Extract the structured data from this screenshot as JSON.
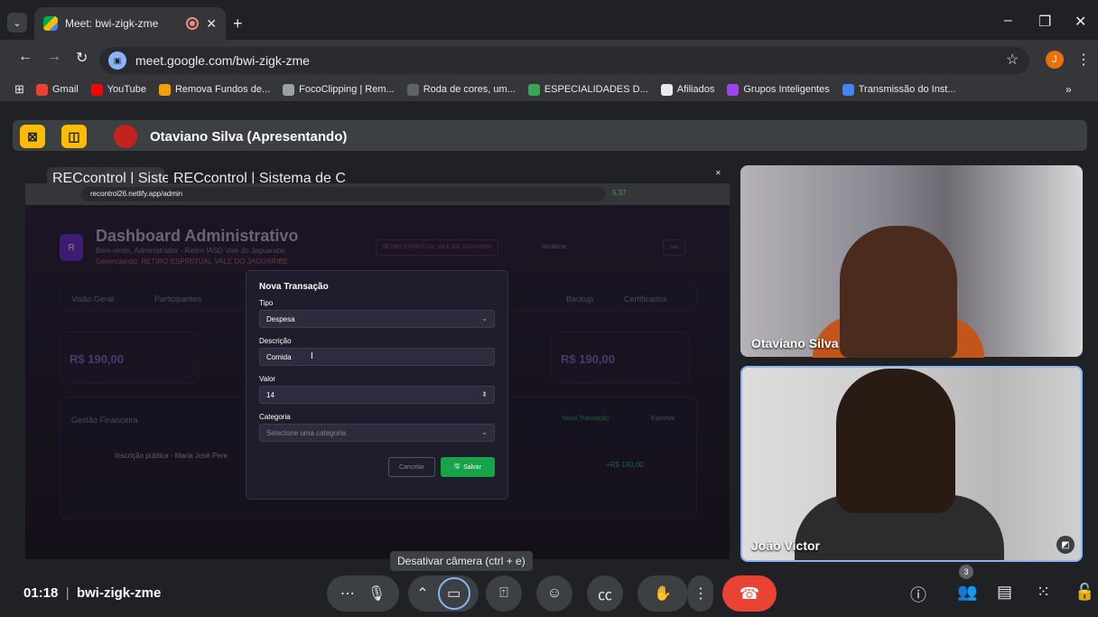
{
  "browser": {
    "tab_title": "Meet: bwi-zigk-zme",
    "url": "meet.google.com/bwi-zigk-zme",
    "profile_initial": "J",
    "bookmarks": [
      {
        "label": "Gmail",
        "color": "#ea4335"
      },
      {
        "label": "YouTube",
        "color": "#ff0000"
      },
      {
        "label": "Remova Fundos de...",
        "color": "#f59e0b"
      },
      {
        "label": "FocoClipping | Rem...",
        "color": "#9aa0a6"
      },
      {
        "label": "Roda de cores, um...",
        "color": "#5f6368"
      },
      {
        "label": "ESPECIALIDADES D...",
        "color": "#34a853"
      },
      {
        "label": "Afiliados",
        "color": "#e8eaed"
      },
      {
        "label": "Grupos Inteligentes",
        "color": "#a142f4"
      },
      {
        "label": "Transmissão do Inst...",
        "color": "#4285f4"
      }
    ],
    "more_bookmarks": "»"
  },
  "presenting": {
    "label": "Otaviano Silva (Apresentando)"
  },
  "shared": {
    "tab1": "RECcontrol | Sistema de C",
    "tab2": "RECcontrol | Sistema de C",
    "url": "recontrol26.netlify.app/admin",
    "ext_badge": "5,37",
    "title": "Dashboard Administrativo",
    "subtitle": "Bem-vindo, Administrador - Retiro IASD Vale do Jaguarabe",
    "location": "Gerenciando: RETIRO ESPIRITUAL VALE DO JAGUARIBE",
    "chip1": "RETIRO ESPIRITUAL VALE DO JAGUARIBE",
    "chip2": "Atualizar",
    "chip3": "Sair",
    "navtabs": [
      "Visão Geral",
      "Participantes",
      "Backup",
      "Certificados"
    ],
    "card1": "R$ 190,00",
    "card2": "R$ 190,00",
    "section": "Gestão Financeira",
    "new_tx": "Nova Transação",
    "export": "Exportar",
    "row": "Inscrição pública - Maria José Pere",
    "row_amount": "+R$ 190,00",
    "modal": {
      "title": "Nova Transação",
      "tipo_label": "Tipo",
      "tipo_value": "Despesa",
      "desc_label": "Descrição",
      "desc_value": "Comida",
      "valor_label": "Valor",
      "valor_value": "14",
      "cat_label": "Categoria",
      "cat_placeholder": "Selecione uma categoria",
      "cancel": "Cancelar",
      "save": "Salvar"
    }
  },
  "participants": [
    {
      "name": "Otaviano Silva"
    },
    {
      "name": "João Victor"
    }
  ],
  "tooltip": "Desativar câmera (ctrl + e)",
  "meeting": {
    "time": "01:18",
    "code": "bwi-zigk-zme"
  },
  "people_count": "3"
}
